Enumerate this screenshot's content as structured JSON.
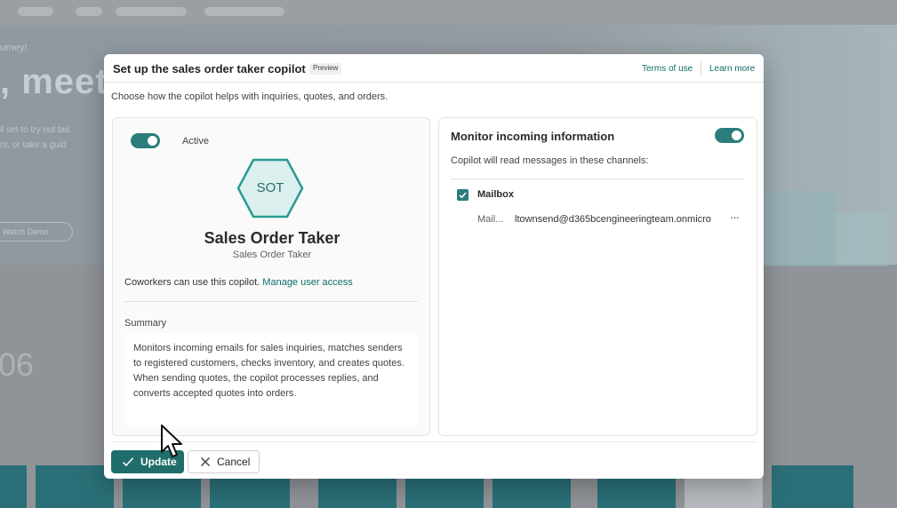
{
  "background": {
    "hero_title": ", meet B",
    "hero_small": "urney!",
    "hero_lines": [
      "ll set to try out tas",
      "rs, or take a guid"
    ],
    "hero_pill": "Watch Demo",
    "big_number": "06"
  },
  "dialog": {
    "title": "Set up the sales order taker copilot",
    "badge": "Preview",
    "links": {
      "terms": "Terms of use",
      "learn": "Learn more"
    },
    "subtitle": "Choose how the copilot helps with inquiries, quotes, and orders.",
    "left": {
      "toggle_on": true,
      "active_label": "Active",
      "icon_initials": "SOT",
      "agent_name": "Sales Order Taker",
      "agent_subtitle": "Sales Order Taker",
      "coworkers_text": "Coworkers can use this copilot.",
      "manage_link": "Manage user access",
      "summary_label": "Summary",
      "summary_text": "Monitors incoming emails for sales inquiries, matches senders to registered customers, checks inventory, and creates quotes. When sending quotes, the copilot processes replies, and converts accepted quotes into orders."
    },
    "right": {
      "title": "Monitor incoming information",
      "toggle_on": true,
      "description": "Copilot will read messages in these channels:",
      "channel": {
        "checked": true,
        "label": "Mailbox",
        "type": "Mail...",
        "address": "ltownsend@d365bcengineeringteam.onmicro"
      }
    },
    "footer": {
      "update_label": "Update",
      "cancel_label": "Cancel"
    }
  },
  "colors": {
    "accent": "#2a7d7a",
    "primary_button": "#1f6e6b",
    "link": "#0f6c68"
  }
}
